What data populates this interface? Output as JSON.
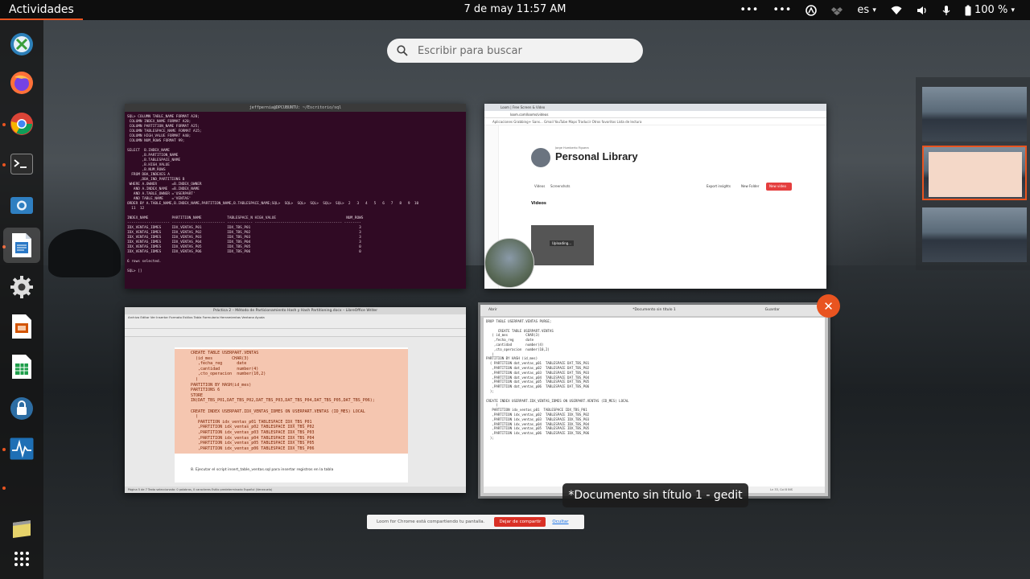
{
  "topbar": {
    "activities": "Actividades",
    "clock": "7 de may  11:57 AM",
    "language": "es",
    "battery": "100 %"
  },
  "search": {
    "placeholder": "Escribir para buscar"
  },
  "windows": {
    "terminal": {
      "title": "jeffpernia@DPCUBUNTU: ~/Escritorio/sql",
      "lines": [
        "SQL> COLUMN TABLE_NAME FORMAT A20;",
        " COLUMN INDEX_NAME FORMAT A20;",
        " COLUMN PARTITION_NAME FORMAT A25;",
        " COLUMN TABLESPACE_NAME FORMAT A15;",
        " COLUMN HIGH_VALUE FORMAT A40;",
        " COLUMN NUM_ROWS FORMAT 99;",
        "",
        "SELECT  B.INDEX_NAME",
        "       ,B.PARTITION_NAME",
        "       ,B.TABLESPACE_NAME",
        "       ,B.HIGH_VALUE",
        "       ,B.NUM_ROWS",
        "  FROM DBA_INDEXES A",
        "      ,DBA_IND_PARTITIONS B",
        " WHERE A.OWNER       =B.INDEX_OWNER",
        "   AND A.INDEX_NAME  =B.INDEX_NAME",
        "   AND A.TABLE_OWNER ='USERPART'",
        "   AND TABLE_NAME    ='VENTAS'",
        "ORDER BY A.TABLE_NAME,B.INDEX_NAME,PARTITION_NAME,B.TABLESPACE_NAME;SQL>  SQL>  SQL>  SQL>  SQL>  SQL>  2   3   4   5   6   7   8   9  10",
        "  11  12",
        "",
        "INDEX_NAME           PARTITION_NAME            TABLESPACE_N HIGH_VALUE                                 NUM_ROWS",
        "-------------------- ------------------------- ------------ ----------------------------------------- --------",
        "IDX_VENTAS_IDMES     IDX_VENTAS_P01            IDX_TBS_P01                                                   3",
        "IDX_VENTAS_IDMES     IDX_VENTAS_P02            IDX_TBS_P02                                                   3",
        "IDX_VENTAS_IDMES     IDX_VENTAS_P03            IDX_TBS_P03                                                   3",
        "IDX_VENTAS_IDMES     IDX_VENTAS_P04            IDX_TBS_P04                                                   3",
        "IDX_VENTAS_IDMES     IDX_VENTAS_P05            IDX_TBS_P05                                                   0",
        "IDX_VENTAS_IDMES     IDX_VENTAS_P06            IDX_TBS_P06                                                   0",
        "",
        "6 rows selected.",
        "",
        "SQL> []"
      ]
    },
    "chrome": {
      "tab": "Loom | Free Screen & Video",
      "url": "loom.com/looms/videos",
      "bookmarks": "Aplicaciones   Grabbing+ Sans...   Gmail   YouTube   Maps   Traducir                                       Otros favoritos   Lista de lectura",
      "owner": "Jorge Humberto Figuera",
      "library_title": "Personal Library",
      "tabs": [
        "Videos",
        "Screenshots"
      ],
      "buttons": [
        "Export insights",
        "New Folder",
        "New video"
      ],
      "videos_header": "Videos",
      "thumb_label": "Uploading..."
    },
    "writer": {
      "title": "Práctica 2 – Método de Particionamiento Hash y Hash Partitioning.docx – LibreOffice Writer",
      "menu": "Archivo  Editar  Ver  Insertar  Formato  Estilos  Tabla  Formulario  Herramientas  Ventana  Ayuda",
      "code": [
        "CREATE TABLE USERPART.VENTAS",
        "  (id_mes        CHAR(3)",
        "   ,fecha_reg      date",
        "   ,cantidad       number(4)",
        "   ,cto_operacion  number(10,2)",
        "  )",
        "PARTITION BY HASH(id_mes)",
        "PARTITIONS 6",
        "STORE",
        "IN(DAT_TBS_P01,DAT_TBS_P02,DAT_TBS_P03,DAT_TBS_P04,DAT_TBS_P05,DAT_TBS_P06);",
        "",
        "CREATE INDEX USERPART.IDX_VENTAS_IDMES ON USERPART.VENTAS (ID_MES) LOCAL",
        "  (",
        "   PARTITION idx_ventas_p01 TABLESPACE IDX_TBS_P01",
        "   ,PARTITION idx_ventas_p02 TABLESPACE IDX_TBS_P02",
        "   ,PARTITION idx_ventas_p03 TABLESPACE IDX_TBS_P03",
        "   ,PARTITION idx_ventas_p04 TABLESPACE IDX_TBS_P04",
        "   ,PARTITION idx_ventas_p05 TABLESPACE IDX_TBS_P05",
        "   ,PARTITION idx_ventas_p06 TABLESPACE IDX_TBS_P06"
      ],
      "step": "8.      Ejecutar el script insert_table_ventas.sql para insertar registros en la tabla",
      "status": "Página 5 de 7    Texto seleccionado: 0 palabras, 0 caracteres    Estilo predeterminado    Español (Venezuela)"
    },
    "gedit": {
      "title": "*Documento sin título 1",
      "open_label": "Abrir",
      "save_label": "Guardar",
      "lines": [
        "DROP TABLE USERPART.VENTAS PURGE;",
        "",
        "      CREATE TABLE USERPART.VENTAS",
        "   ( id_mes         CHAR(3)",
        "    ,fecha_reg      date",
        "    ,cantidad       number(4)",
        "    ,cto_operacion  number(10,2)",
        "   )",
        "PARTITION BY HASH (id_mes)",
        "  ( PARTITION dat_ventas_p01  TABLESPACE DAT_TBS_P01",
        "   ,PARTITION dat_ventas_p02  TABLESPACE DAT_TBS_P02",
        "   ,PARTITION dat_ventas_p03  TABLESPACE DAT_TBS_P03",
        "   ,PARTITION dat_ventas_p04  TABLESPACE DAT_TBS_P04",
        "   ,PARTITION dat_ventas_p05  TABLESPACE DAT_TBS_P05",
        "   ,PARTITION dat_ventas_p06  TABLESPACE DAT_TBS_P06",
        "  );",
        "",
        "CREATE INDEX USERPART.IDX_VENTAS_IDMES ON USERPART.VENTAS (ID_MES) LOCAL",
        "     (",
        "   PARTITION idx_ventas_p01  TABLESPACE IDX_TBS_P01",
        "   ,PARTITION idx_ventas_p02  TABLESPACE IDX_TBS_P02",
        "   ,PARTITION idx_ventas_p03  TABLESPACE IDX_TBS_P03",
        "   ,PARTITION idx_ventas_p04  TABLESPACE IDX_TBS_P04",
        "   ,PARTITION idx_ventas_p05  TABLESPACE IDX_TBS_P05",
        "   ,PARTITION idx_ventas_p06  TABLESPACE IDX_TBS_P06",
        "  );"
      ],
      "status": "Ln 33, Col 8    INS"
    }
  },
  "tooltip": "*Documento sin título 1 - gedit",
  "loom_bar": {
    "message": "Loom for Chrome está compartiendo tu pantalla.",
    "stop_label": "Dejar de compartir",
    "hide_label": "Ocultar"
  },
  "colors": {
    "accent": "#e95420",
    "terminal_bg": "#300a24",
    "topbar_bg": "#0e0e0e"
  }
}
